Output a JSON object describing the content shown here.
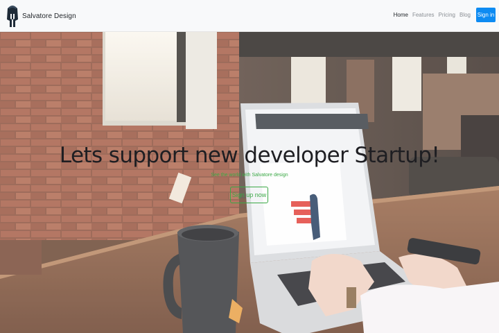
{
  "navbar": {
    "brand": {
      "name": "Salvatore Design",
      "logo_icon": "spartan-helmet-icon"
    },
    "links": [
      {
        "label": "Home",
        "active": true
      },
      {
        "label": "Features",
        "active": false
      },
      {
        "label": "Pricing",
        "active": false
      },
      {
        "label": "Blog",
        "active": false
      }
    ],
    "signin_label": "Sign in"
  },
  "hero": {
    "title": "Lets support new developer Startup!",
    "subtitle": "See the world with Salvatore design",
    "cta_label": "Sign up now",
    "background_image": "photo-laptop-on-wooden-desk-brick-wall"
  },
  "colors": {
    "navbar_bg": "#f8f9fa",
    "primary": "#0d8bf2",
    "accent_green": "#3aa845",
    "title_text": "#1e1e22"
  }
}
